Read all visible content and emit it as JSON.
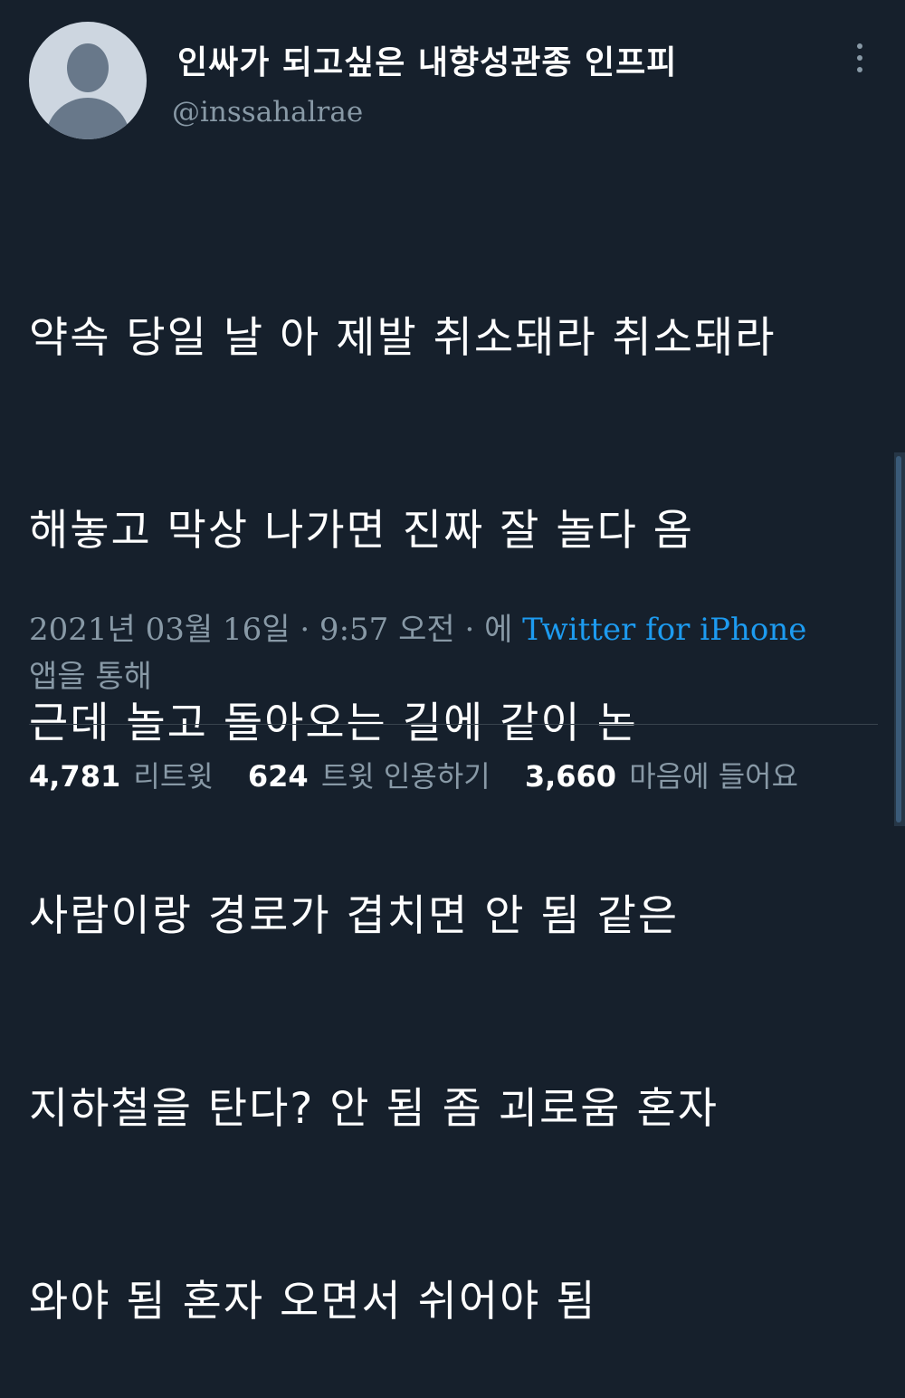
{
  "author": {
    "display_name": "인싸가 되고싶은 내향성관종 인프피",
    "handle": "@inssahalrae",
    "avatar_icon": "default-avatar-icon"
  },
  "tweet": {
    "lines": [
      "약속 당일 날 아 제발 취소돼라 취소돼라",
      "해놓고 막상 나가면 진짜 잘 놀다 옴",
      "근데 놀고 돌아오는 길에 같이 논",
      "사람이랑 경로가 겹치면 안 됨 같은",
      "지하철을 탄다? 안 됨 좀 괴로움 혼자",
      "와야 됨 혼자 오면서 쉬어야 됨"
    ]
  },
  "meta": {
    "date_time": "2021년 03월 16일 · 9:57 오전 · 에 ",
    "source": "Twitter for iPhone",
    "suffix": "앱을 통해"
  },
  "stats": {
    "retweets": "4,781",
    "retweets_label": "리트윗",
    "quotes": "624",
    "quotes_label": "트윗 인용하기",
    "likes": "3,660",
    "likes_label": "마음에 들어요"
  },
  "colors": {
    "background": "#16202c",
    "secondary_text": "#8899a6",
    "link": "#1d9bf0"
  },
  "icons": {
    "more": "more-options-icon"
  }
}
